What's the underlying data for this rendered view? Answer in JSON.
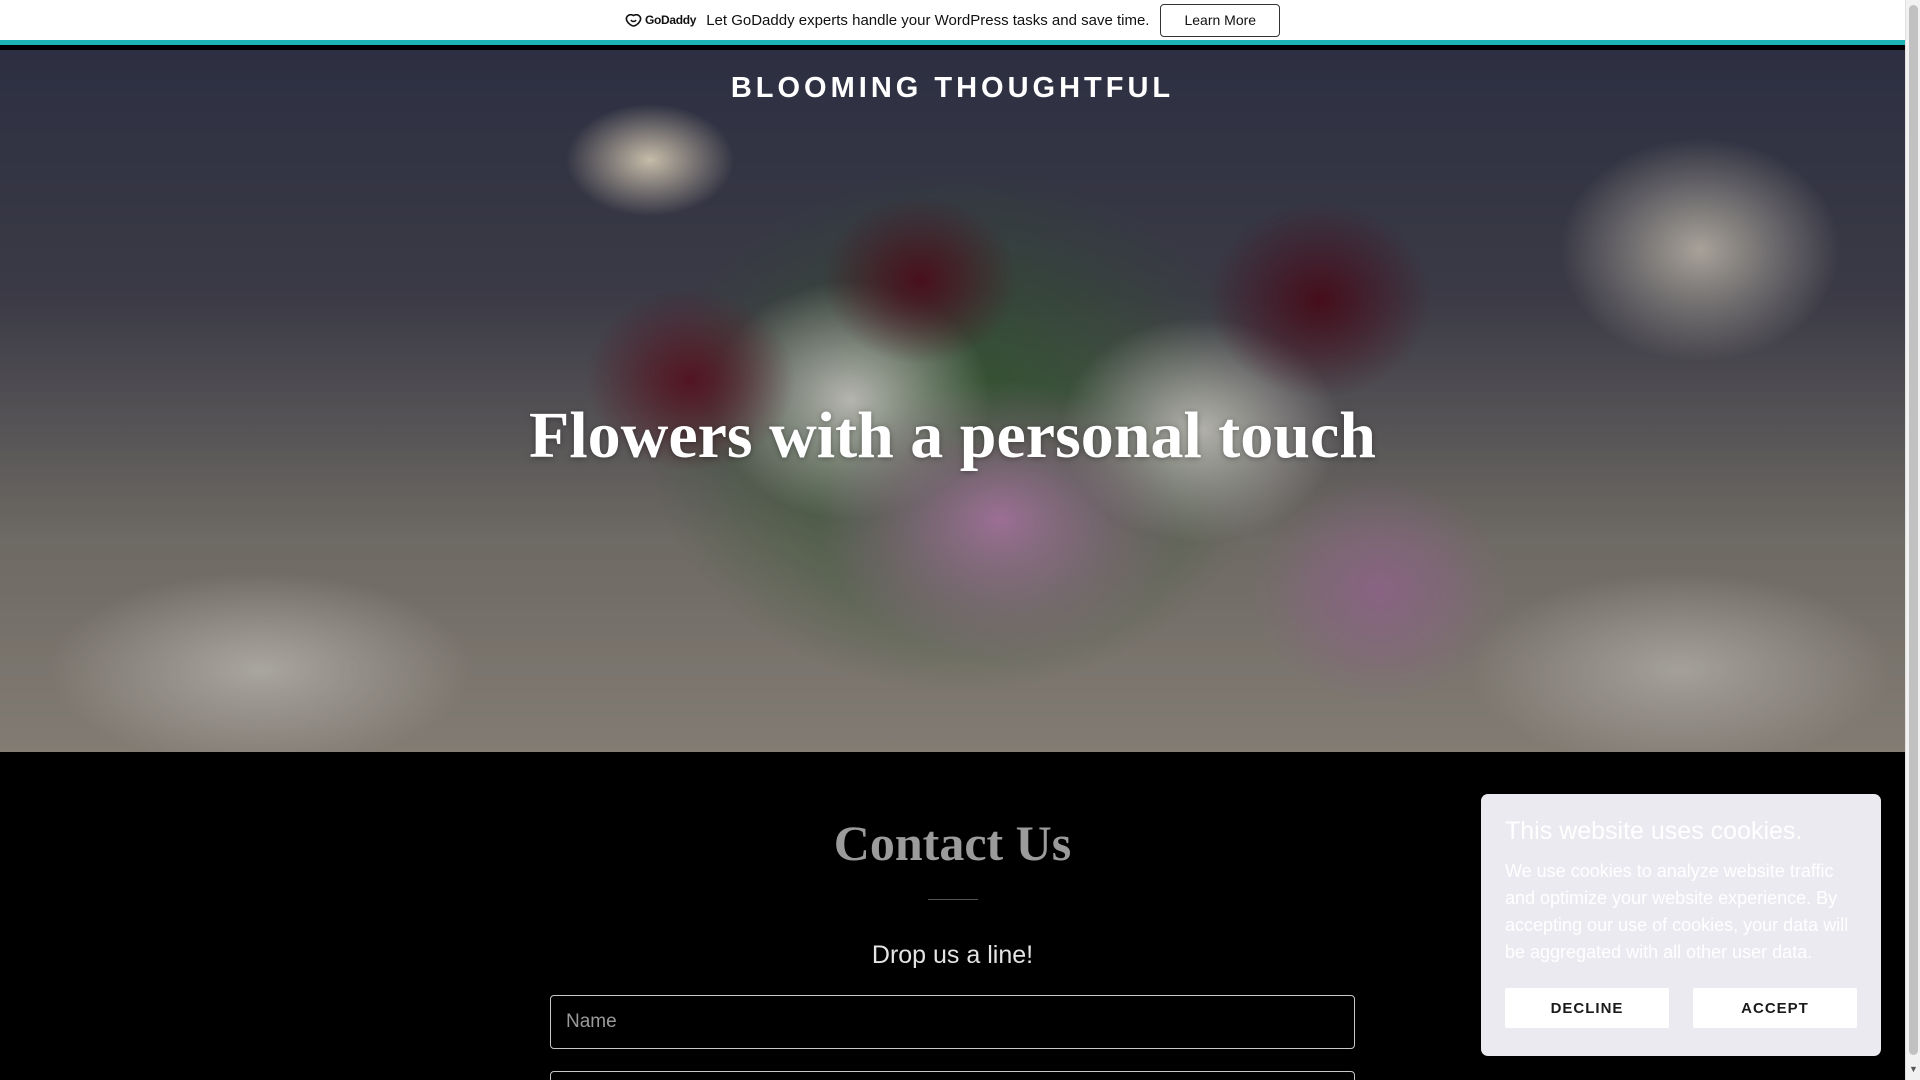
{
  "promo": {
    "logo_text": "GoDaddy",
    "message": "Let GoDaddy experts handle your WordPress tasks and save time.",
    "button_label": "Learn More",
    "accent_color": "#1bb3b3"
  },
  "hero": {
    "site_title": "BLOOMING THOUGHTFUL",
    "heading": "Flowers with a personal touch"
  },
  "contact": {
    "title": "Contact Us",
    "subtitle": "Drop us a line!",
    "name_placeholder": "Name"
  },
  "cookie_banner": {
    "title": "This website uses cookies.",
    "body": "We use cookies to analyze website traffic and optimize your website experience. By accepting our use of cookies, your data will be aggregated with all other user data.",
    "decline_label": "DECLINE",
    "accept_label": "ACCEPT"
  },
  "icons": {
    "logo": "godaddy-logo-icon",
    "scroll_down": "chevron-down-icon"
  }
}
